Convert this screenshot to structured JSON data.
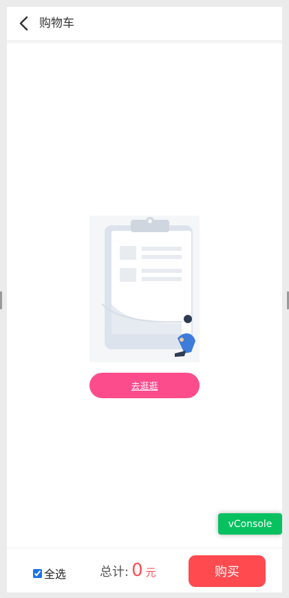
{
  "header": {
    "title": "购物车"
  },
  "empty_state": {
    "button_label": "去逛逛"
  },
  "vconsole": {
    "label": "vConsole"
  },
  "bottom_bar": {
    "select_all_label": "全选",
    "select_all_checked": true,
    "total_label": "总计:",
    "total_amount": "0",
    "total_unit": "元",
    "buy_label": "购买"
  },
  "colors": {
    "accent_pink": "#fd4c8c",
    "buy_red": "#ff4a50",
    "price_red": "#ff4d55",
    "vconsole_green": "#07c160"
  }
}
